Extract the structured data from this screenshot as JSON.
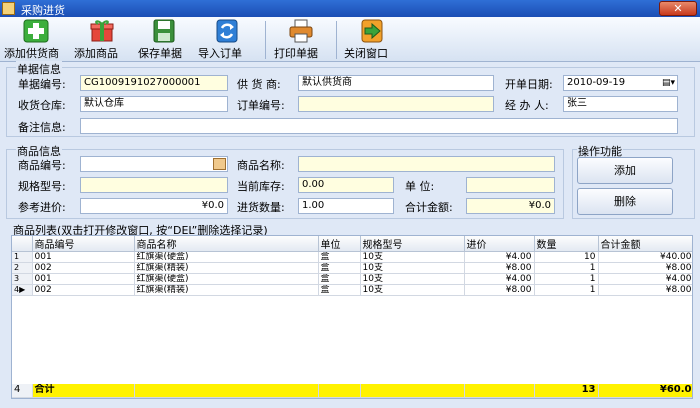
{
  "window": {
    "title": "采购进货",
    "close_label": "✕"
  },
  "toolbar": {
    "add_supplier": "添加供货商",
    "add_product": "添加商品",
    "save_doc": "保存单据",
    "import_order": "导入订单",
    "print_doc": "打印单据",
    "close_window": "关闭窗口"
  },
  "doc_info": {
    "title": "单据信息",
    "doc_no_label": "单据编号:",
    "doc_no": "CG1009191027000001",
    "supplier_label": "供 货 商:",
    "supplier": "默认供货商",
    "date_label": "开单日期:",
    "date": "2010-09-19",
    "warehouse_label": "收货仓库:",
    "warehouse": "默认仓库",
    "order_no_label": "订单编号:",
    "order_no": "",
    "handler_label": "经 办 人:",
    "handler": "张三",
    "remark_label": "备注信息:",
    "remark": ""
  },
  "product_info": {
    "title": "商品信息",
    "code_label": "商品编号:",
    "code": "",
    "name_label": "商品名称:",
    "name": "",
    "spec_label": "规格型号:",
    "spec": "",
    "stock_label": "当前库存:",
    "stock": "0.00",
    "unit_label": "单    位:",
    "unit": "",
    "ref_price_label": "参考进价:",
    "ref_price": "¥0.0",
    "qty_label": "进货数量:",
    "qty": "1.00",
    "amount_label": "合计金额:",
    "amount": "¥0.0"
  },
  "operations": {
    "title": "操作功能",
    "add": "添加",
    "delete": "删除"
  },
  "list": {
    "caption": "商品列表(双击打开修改窗口, 按“DEL”删除选择记录)",
    "columns": [
      "商品编号",
      "商品名称",
      "单位",
      "规格型号",
      "进价",
      "数量",
      "合计金额"
    ],
    "rows": [
      {
        "idx": "1",
        "code": "001",
        "name": "红旗渠(硬盒)",
        "unit": "盒",
        "spec": "10支",
        "price": "¥4.00",
        "qty": "10",
        "total": "¥40.00"
      },
      {
        "idx": "2",
        "code": "002",
        "name": "红旗渠(精装)",
        "unit": "盒",
        "spec": "10支",
        "price": "¥8.00",
        "qty": "1",
        "total": "¥8.00"
      },
      {
        "idx": "3",
        "code": "001",
        "name": "红旗渠(硬盒)",
        "unit": "盒",
        "spec": "10支",
        "price": "¥4.00",
        "qty": "1",
        "total": "¥4.00"
      },
      {
        "idx": "4",
        "code": "002",
        "name": "红旗渠(精装)",
        "unit": "盒",
        "spec": "10支",
        "price": "¥8.00",
        "qty": "1",
        "total": "¥8.00"
      }
    ],
    "total": {
      "idx": "4",
      "label": "合计",
      "qty": "13",
      "amount": "¥60.0"
    }
  },
  "icons": {
    "app": "app-icon",
    "add_supplier": "green-plus-icon",
    "add_product": "gift-box-icon",
    "save": "floppy-disk-icon",
    "import": "refresh-arrows-icon",
    "print": "printer-icon",
    "close": "exit-arrow-icon",
    "calendar": "calendar-dropdown-icon",
    "lookup": "lookup-icon"
  }
}
